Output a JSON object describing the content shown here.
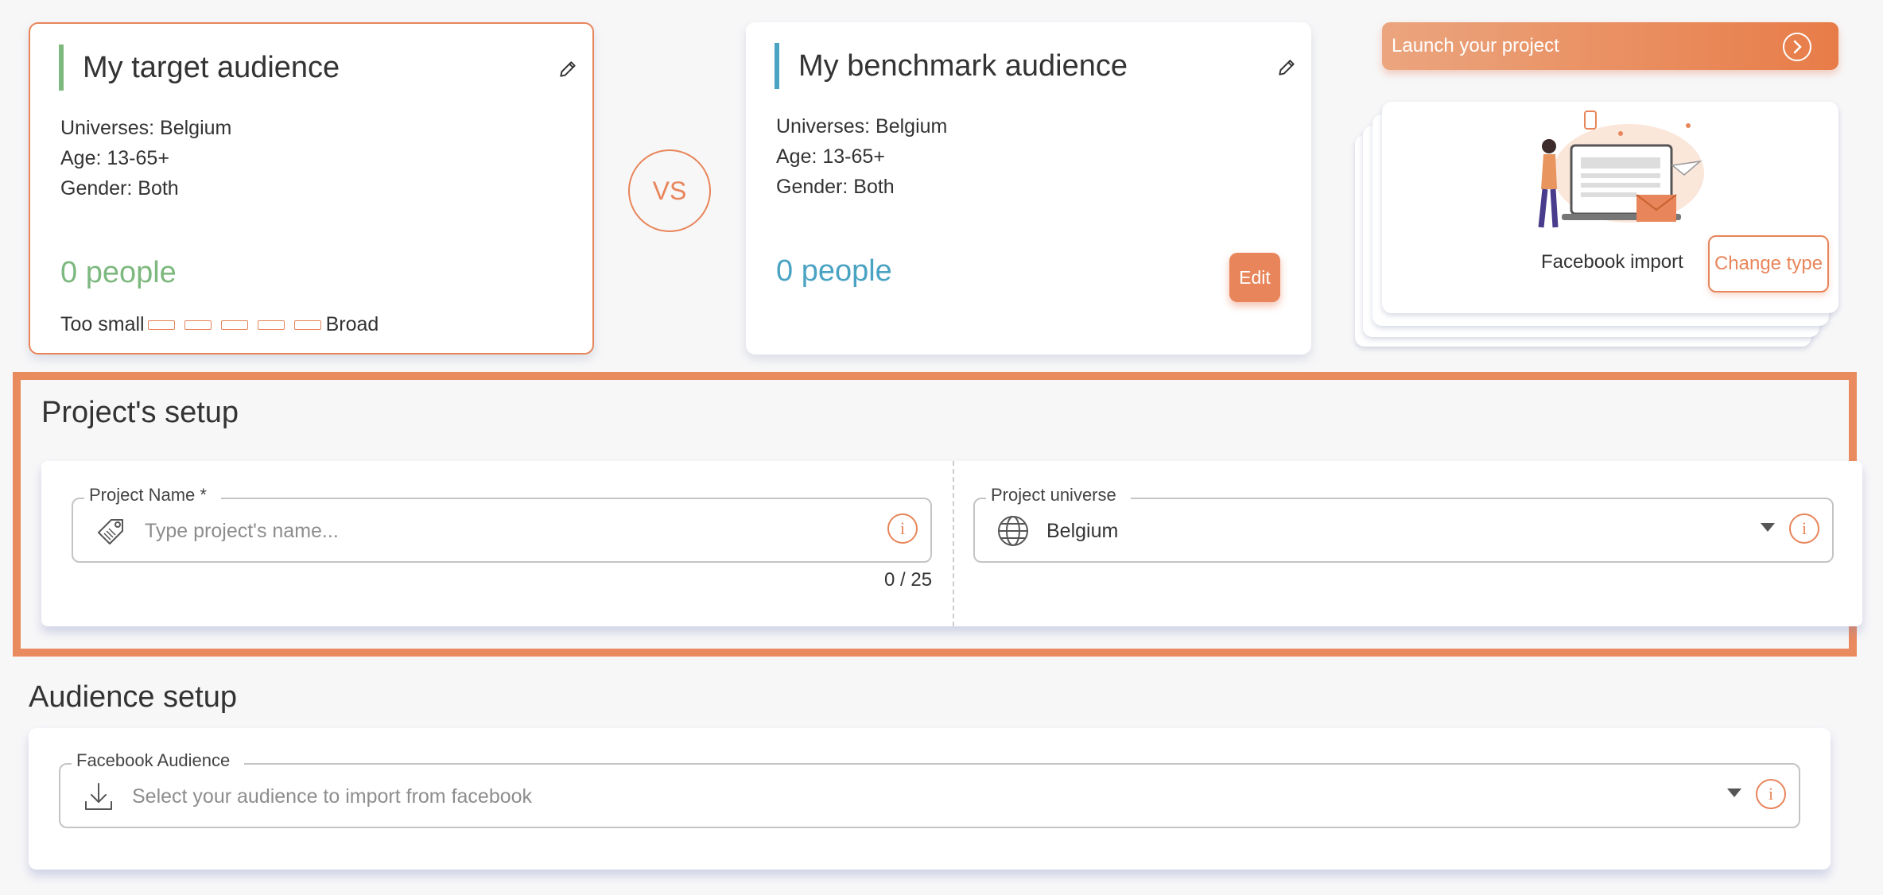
{
  "target_audience": {
    "title": "My target audience",
    "universes": "Universes: Belgium",
    "age": "Age: 13-65+",
    "gender": "Gender: Both",
    "people": "0 people",
    "scale_min": "Too small",
    "scale_max": "Broad"
  },
  "vs_label": "VS",
  "benchmark_audience": {
    "title": "My benchmark audience",
    "universes": "Universes: Belgium",
    "age": "Age: 13-65+",
    "gender": "Gender: Both",
    "people": "0 people",
    "edit_label": "Edit"
  },
  "launch": {
    "label": "Launch your project"
  },
  "project_type": {
    "label": "Facebook import",
    "change_label": "Change type"
  },
  "project_setup": {
    "title": "Project's setup",
    "name_label": "Project Name  *",
    "name_placeholder": "Type project's name...",
    "name_counter": "0 / 25",
    "universe_label": "Project universe",
    "universe_value": "Belgium",
    "info_glyph": "i"
  },
  "audience_setup": {
    "title": "Audience setup",
    "fb_label": "Facebook Audience",
    "fb_placeholder": "Select your audience to import from facebook",
    "info_glyph": "i"
  },
  "colors": {
    "accent": "#e8855a",
    "target_green": "#7db87f",
    "benchmark_blue": "#4aa3c3",
    "background": "#f7f7f8"
  }
}
